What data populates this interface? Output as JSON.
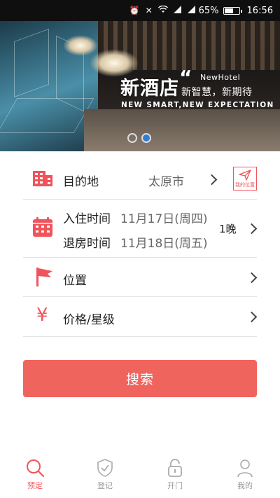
{
  "status_bar": {
    "battery_pct": "65%",
    "time": "16:56",
    "icons": [
      "alarm-icon",
      "silent-icon",
      "wifi-icon",
      "signal-icon",
      "signal-icon",
      "battery-icon"
    ]
  },
  "banner": {
    "brand_cn": "新酒店",
    "quote_mark": "“",
    "brand_en": "NewHotel",
    "slogan_cn": "新智慧，新期待",
    "slogan_en": "NEW SMART,NEW EXPECTATION",
    "slide_count": 2,
    "active_slide": 2
  },
  "form": {
    "destination": {
      "label": "目的地",
      "value": "太原市",
      "icon": "building-icon"
    },
    "my_location": {
      "label": "我的位置",
      "icon": "location-arrow-icon"
    },
    "dates": {
      "icon": "calendar-icon",
      "checkin_label": "入住时间",
      "checkin_value": "11月17日(周四)",
      "checkout_label": "退房时间",
      "checkout_value": "11月18日(周五)",
      "nights": "1晚"
    },
    "location": {
      "label": "位置",
      "icon": "flag-icon"
    },
    "price": {
      "label": "价格/星级",
      "icon": "yen-icon",
      "icon_glyph": "¥"
    },
    "search_button": "搜索"
  },
  "tabbar": {
    "items": [
      {
        "label": "预定",
        "icon": "search-icon",
        "active": true
      },
      {
        "label": "登记",
        "icon": "shield-check-icon",
        "active": false
      },
      {
        "label": "开门",
        "icon": "unlock-icon",
        "active": false
      },
      {
        "label": "我的",
        "icon": "user-icon",
        "active": false
      }
    ]
  },
  "colors": {
    "accent": "#f0545a",
    "button": "#f0645e",
    "inactive": "#999999",
    "divider": "#e4e4e4",
    "slide_active": "#2f7fd1"
  }
}
